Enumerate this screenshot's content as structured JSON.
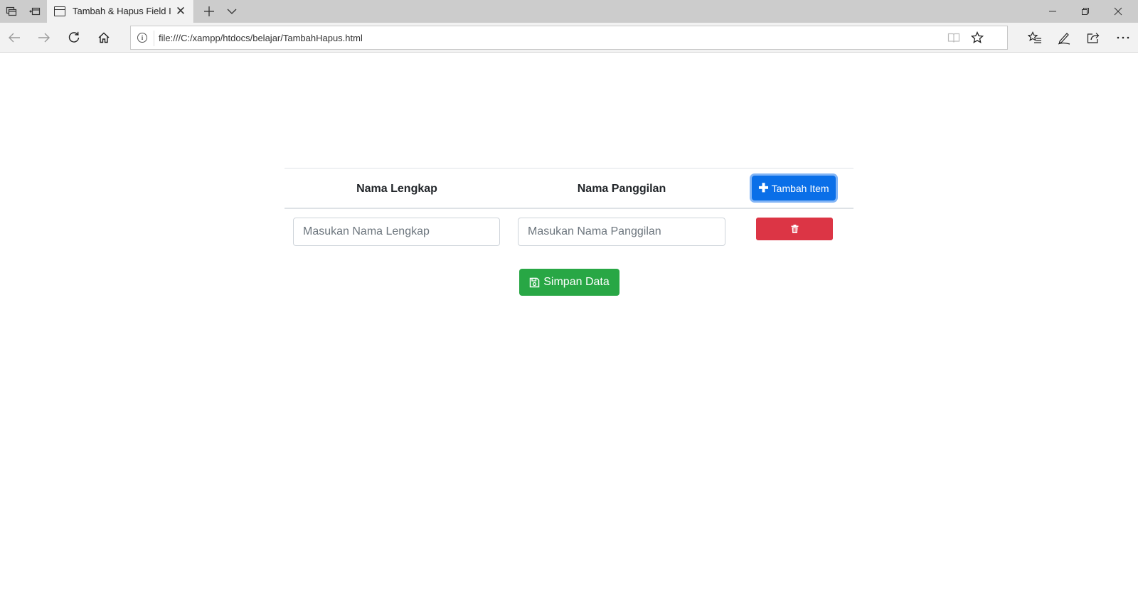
{
  "browser": {
    "tab_title": "Tambah & Hapus Field I",
    "url": "file:///C:/xampp/htdocs/belajar/TambahHapus.html",
    "icons": {
      "tab_actions": "tab-list-icon",
      "set_aside": "set-aside-tabs-icon",
      "new_tab": "plus-icon",
      "tab_dropdown": "chevron-down-icon",
      "back": "arrow-left-icon",
      "forward": "arrow-right-icon",
      "refresh": "refresh-icon",
      "home": "home-icon",
      "reading_view": "book-icon",
      "favorite": "star-icon",
      "favorites_hub": "star-list-icon",
      "web_note": "pen-icon",
      "share": "share-icon",
      "more": "ellipsis-icon"
    }
  },
  "table": {
    "headers": [
      "Nama Lengkap",
      "Nama Panggilan"
    ],
    "add_button_label": "Tambah Item",
    "rows": [
      {
        "full_name_placeholder": "Masukan Nama Lengkap",
        "nickname_placeholder": "Masukan Nama Panggilan"
      }
    ]
  },
  "save_button_label": "Simpan Data",
  "colors": {
    "primary": "#0a6fe8",
    "danger": "#dc3545",
    "success": "#28a745"
  }
}
